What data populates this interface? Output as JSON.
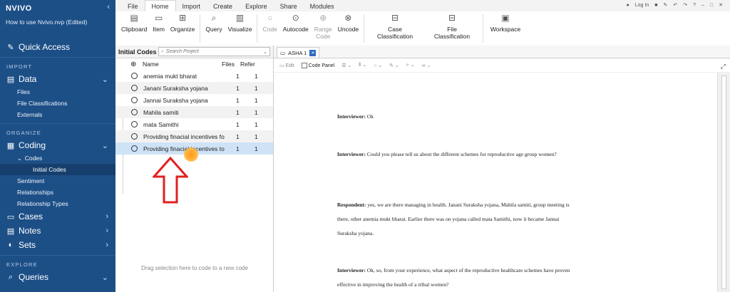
{
  "app": {
    "logo": "NVIVO",
    "project": "How to use Nvivo.nvp (Edited)"
  },
  "sidebar": {
    "quick_access": "Quick Access",
    "import_label": "IMPORT",
    "data": "Data",
    "files": "Files",
    "file_classifications": "File Classifications",
    "externals": "Externals",
    "organize_label": "ORGANIZE",
    "coding": "Coding",
    "codes": "Codes",
    "initial_codes": "Initial Codes",
    "sentiment": "Sentiment",
    "relationships": "Relationships",
    "relationship_types": "Relationship Types",
    "cases": "Cases",
    "notes": "Notes",
    "sets": "Sets",
    "explore_label": "EXPLORE",
    "queries": "Queries"
  },
  "ribbon": {
    "tabs": [
      "File",
      "Home",
      "Import",
      "Create",
      "Explore",
      "Share",
      "Modules"
    ],
    "login": "Log In",
    "tools": {
      "clipboard": "Clipboard",
      "item": "Item",
      "organize": "Organize",
      "query": "Query",
      "visualize": "Visualize",
      "code": "Code",
      "autocode": "Autocode",
      "range_code_1": "Range",
      "range_code_2": "Code",
      "uncode": "Uncode",
      "case_1": "Case",
      "case_2": "Classification",
      "file_1": "File",
      "file_2": "Classification",
      "workspace": "Workspace"
    }
  },
  "panel": {
    "title": "Initial Codes",
    "search_placeholder": "Search Project",
    "col_name": "Name",
    "col_files": "Files",
    "col_refs": "Refer",
    "rows": [
      {
        "name": "anemia mukt bharat",
        "files": "1",
        "refs": "1"
      },
      {
        "name": "Janani Suraksha yojana",
        "files": "1",
        "refs": "1"
      },
      {
        "name": "Jannai Suraksha yojana",
        "files": "1",
        "refs": "1"
      },
      {
        "name": "Mahila samiti",
        "files": "1",
        "refs": "1"
      },
      {
        "name": "mata Samithi",
        "files": "1",
        "refs": "1"
      },
      {
        "name": "Providing  finacial incentives fo",
        "files": "1",
        "refs": "1"
      },
      {
        "name": "Providing finacial incentives to",
        "files": "1",
        "refs": "1"
      }
    ],
    "drag_hint": "Drag selection here to code to a new code"
  },
  "doc": {
    "tab": "ASHA 1",
    "edit": "Edit",
    "code_panel": "Code Panel",
    "paragraphs": [
      {
        "speaker": "Interviewer:",
        "text": " Ok"
      },
      {
        "speaker": "Interviewer:",
        "text": " Could you please tell us about the different schemes for reproductive age group women?"
      },
      {
        "speaker": "Respondent:",
        "text": " yes, we are there managing in health. Janani Suraksha yojana, Mahila samiti, group meeting is there, other anemia mukt bharat. Earlier there was on yojana called mata Samithi, now it became Jannai Suraksha yojana."
      },
      {
        "speaker": "Interviewer:",
        "text": " Ok, so, from your experience, what aspect of the reproductive healthcare schemes have proven effective in improving the health of a tribal women?"
      }
    ]
  },
  "colors": {
    "sidebar": "#1d4f87",
    "selected_row": "#cfe3f7",
    "arrow": "#e02020"
  }
}
